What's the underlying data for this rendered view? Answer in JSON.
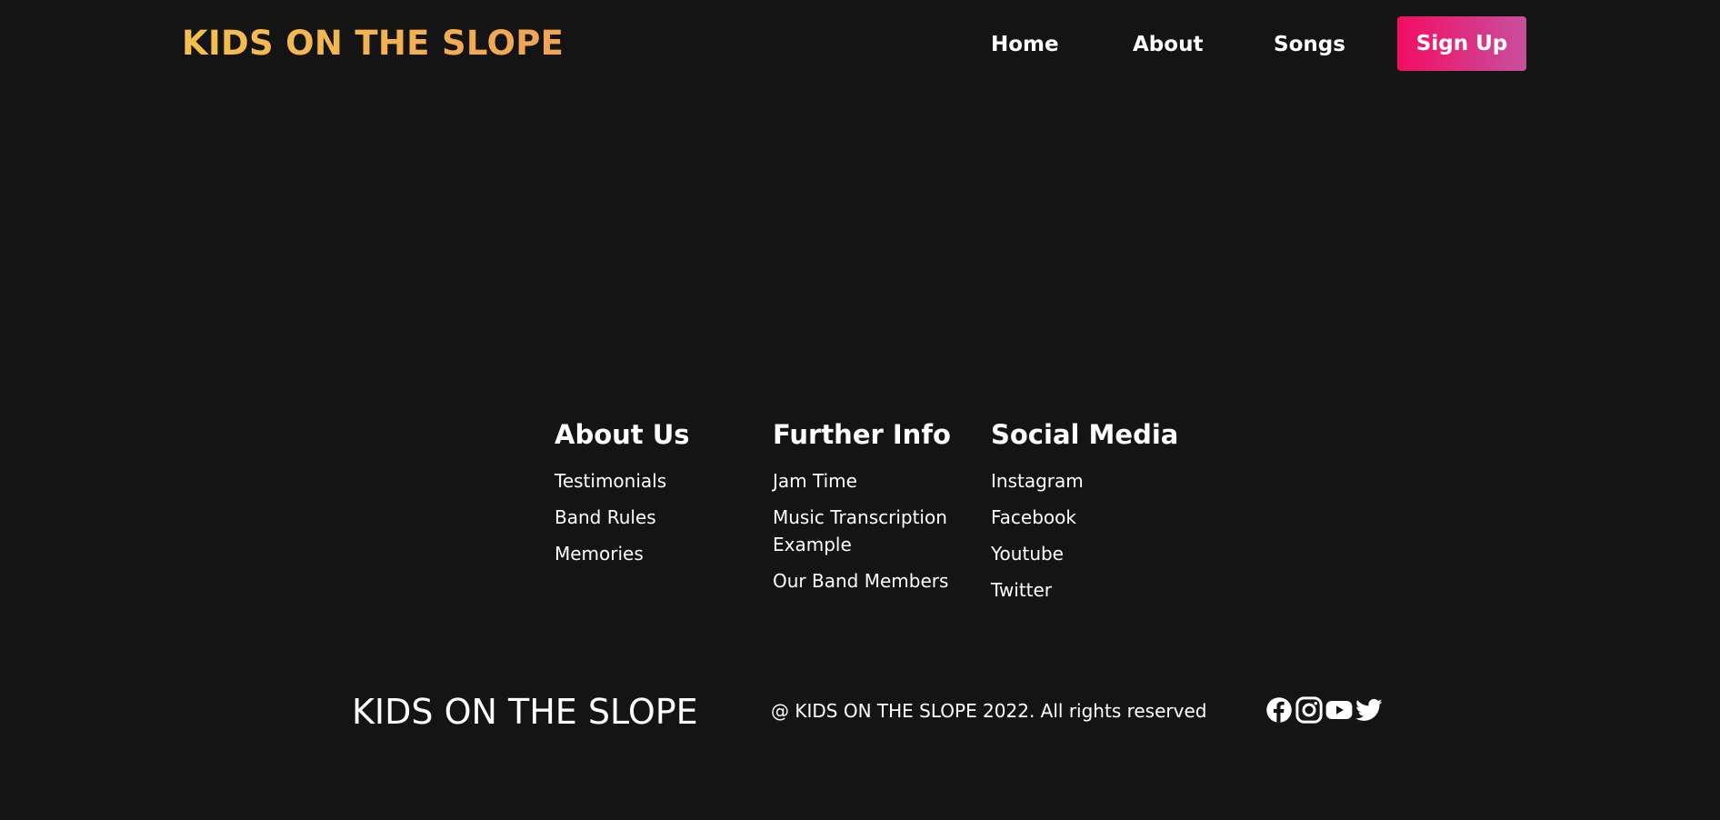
{
  "navbar": {
    "brand": "KIDS ON THE SLOPE",
    "links": [
      "Home",
      "About",
      "Songs"
    ],
    "signup_label": "Sign Up"
  },
  "footer": {
    "columns": [
      {
        "heading": "About Us",
        "items": [
          "Testimonials",
          "Band Rules",
          "Memories"
        ]
      },
      {
        "heading": "Further Info",
        "items": [
          "Jam Time",
          "Music Transcription Example",
          "Our Band Members"
        ]
      },
      {
        "heading": "Social Media",
        "items": [
          "Instagram",
          "Facebook",
          "Youtube",
          "Twitter"
        ]
      }
    ],
    "brand": "KIDS ON THE SLOPE",
    "copyright": "@ KIDS ON THE SLOPE 2022. All rights reserved",
    "social_icons": [
      "facebook-icon",
      "instagram-icon",
      "youtube-icon",
      "twitter-icon"
    ]
  },
  "colors": {
    "background": "#141414",
    "brand_gradient_start": "#f4c04f",
    "brand_gradient_end": "#f0a456",
    "signup_gradient_start": "#f20d63",
    "signup_gradient_end": "#c84f9e",
    "text": "#ffffff"
  }
}
